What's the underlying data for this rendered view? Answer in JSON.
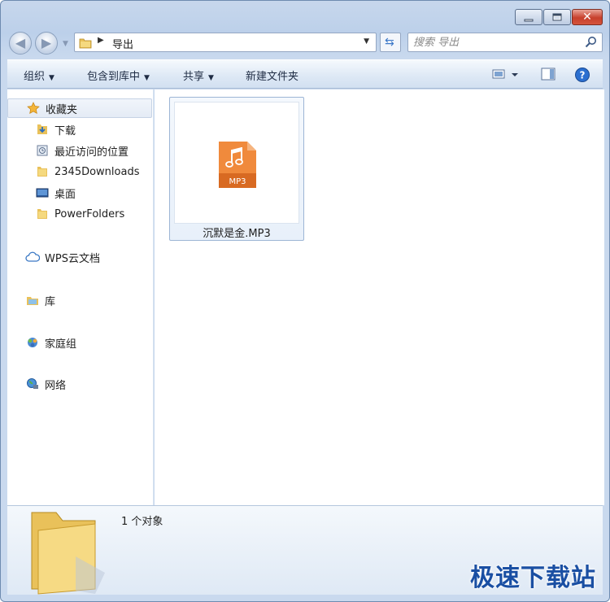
{
  "window": {
    "caption_buttons": [
      "minimize",
      "maximize",
      "close"
    ]
  },
  "address_bar": {
    "crumbs": [
      "导出"
    ],
    "search_placeholder": "搜索 导出"
  },
  "toolbar": {
    "organize": "组织",
    "include_in_library": "包含到库中",
    "share": "共享",
    "new_folder": "新建文件夹"
  },
  "sidebar": {
    "favorites": "收藏夹",
    "favorites_items": [
      "下载",
      "最近访问的位置",
      "2345Downloads",
      "桌面",
      "PowerFolders"
    ],
    "wps_cloud": "WPS云文档",
    "libraries": "库",
    "homegroup": "家庭组",
    "network": "网络"
  },
  "content": {
    "files": [
      {
        "name": "沉默是金.MP3",
        "badge": "MP3",
        "icon": "music-note-icon"
      }
    ]
  },
  "details": {
    "count": "1 个对象"
  },
  "watermark": "极速下载站",
  "colors": {
    "mp3_orange": "#f08a3c",
    "selection_border": "#9db5d5",
    "watermark_blue": "#1a4fa3"
  }
}
